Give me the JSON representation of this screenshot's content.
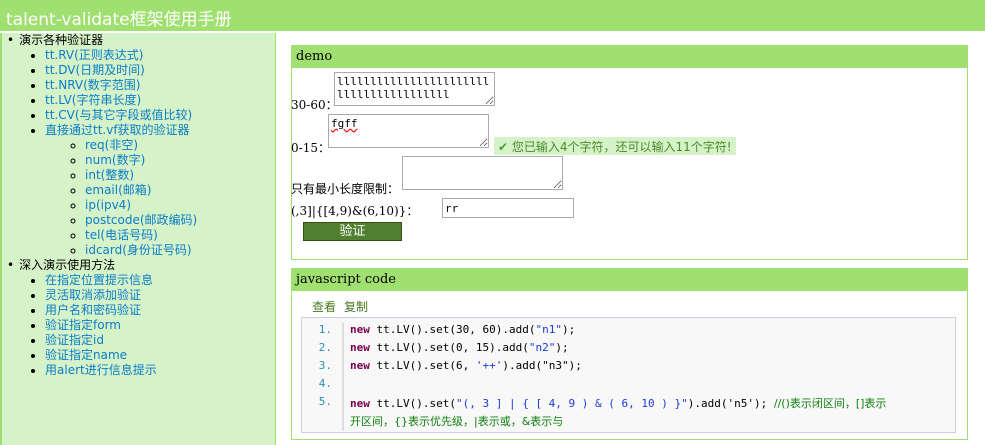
{
  "header": {
    "title": "talent-validate框架使用手册"
  },
  "sidebar": {
    "section1": "演示各种验证器",
    "validators": [
      "tt.RV(正则表达式)",
      "tt.DV(日期及时间)",
      "tt.NRV(数字范围)",
      "tt.LV(字符串长度)",
      "tt.CV(与其它字段或值比较)",
      "直接通过tt.vf获取的验证器"
    ],
    "vf": [
      "req(非空)",
      "num(数字)",
      "int(整数)",
      "email(邮箱)",
      "ip(ipv4)",
      "postcode(邮政编码)",
      "tel(电话号码)",
      "idcard(身份证号码)"
    ],
    "section2": "深入演示使用方法",
    "usage": [
      "在指定位置提示信息",
      "灵活取消添加验证",
      "用户名和密码验证",
      "验证指定form",
      "验证指定id",
      "验证指定name",
      "用alert进行信息提示"
    ]
  },
  "demo": {
    "title": "demo",
    "label1": "30-60：",
    "value1": "llllllllllllllllllllllllllllllllllllllll",
    "label2": "0-15：",
    "value2": "fgff",
    "tip": "您已输入4个字符，还可以输入11个字符!",
    "label3": "只有最小长度限制：",
    "value3": "",
    "label4": "(,3]|{[4,9)&(6,10)}：",
    "value4": "rr",
    "submit": "验证"
  },
  "code": {
    "title": "javascript code",
    "view": "查看",
    "copy": "复制",
    "lines": [
      {
        "n": "1.",
        "kw": "new",
        "a": " tt.LV().set(30, 60).add(",
        "s": "\"n1\"",
        "b": ");"
      },
      {
        "n": "2.",
        "kw": "new",
        "a": " tt.LV().set(0, 15).add(",
        "s": "\"n2\"",
        "b": ");"
      },
      {
        "n": "3.",
        "kw": "new",
        "a": " tt.LV().set(6, ",
        "s": "'++'",
        "b": ").add(\"n3\");"
      },
      {
        "n": "4."
      },
      {
        "n": "5.",
        "kw": "new",
        "a": " tt.LV().set(",
        "s": "\"(, 3 ] | { [ 4, 9 ) & ( 6, 10 ) }\"",
        "b": ").add('n5');  ",
        "c": "//()表示闭区间，[]表示"
      }
    ],
    "cont": "开区间，{}表示优先级，|表示或，&表示与"
  }
}
